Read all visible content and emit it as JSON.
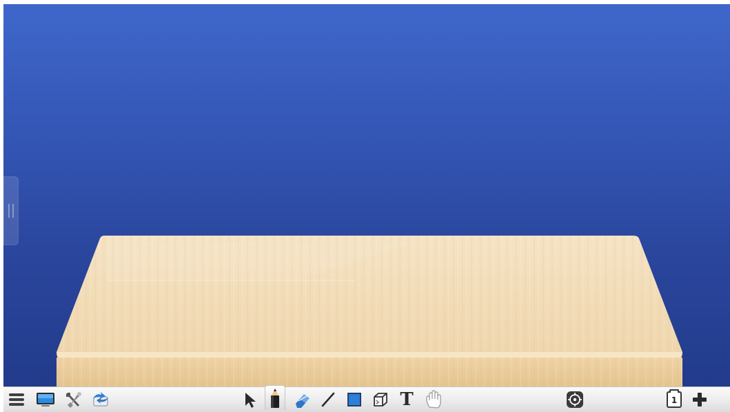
{
  "app": {
    "name": "whiteboard"
  },
  "stage": {
    "background_top": "#3f67cb",
    "background_bottom": "#223b8b",
    "object": "wooden-table"
  },
  "colors": {
    "wood_light": "#f3dfbd",
    "wood_dark": "#e2c697",
    "toolbar_bg": "#e8e8e8",
    "accent_blue": "#2f7fd6"
  },
  "toolbar": {
    "left_tools": [
      {
        "id": "menu",
        "icon": "hamburger-menu-icon"
      },
      {
        "id": "desktop",
        "icon": "monitor-icon"
      },
      {
        "id": "tools",
        "icon": "tools-icon"
      },
      {
        "id": "cloud",
        "icon": "cloud-transfer-icon"
      }
    ],
    "center_tools": [
      {
        "id": "select",
        "icon": "arrow-pointer-icon"
      },
      {
        "id": "pen",
        "icon": "pencil-icon",
        "active": true
      },
      {
        "id": "eraser",
        "icon": "eraser-icon"
      },
      {
        "id": "line",
        "icon": "line-icon"
      },
      {
        "id": "shape",
        "icon": "square-icon"
      },
      {
        "id": "3d",
        "icon": "cube-icon"
      },
      {
        "id": "text",
        "icon": "text-icon",
        "glyph": "T"
      },
      {
        "id": "hand",
        "icon": "hand-icon"
      }
    ],
    "right_tools": [
      {
        "id": "roam",
        "icon": "target-icon"
      }
    ],
    "page": {
      "current": "1",
      "add_icon": "plus-icon"
    }
  }
}
